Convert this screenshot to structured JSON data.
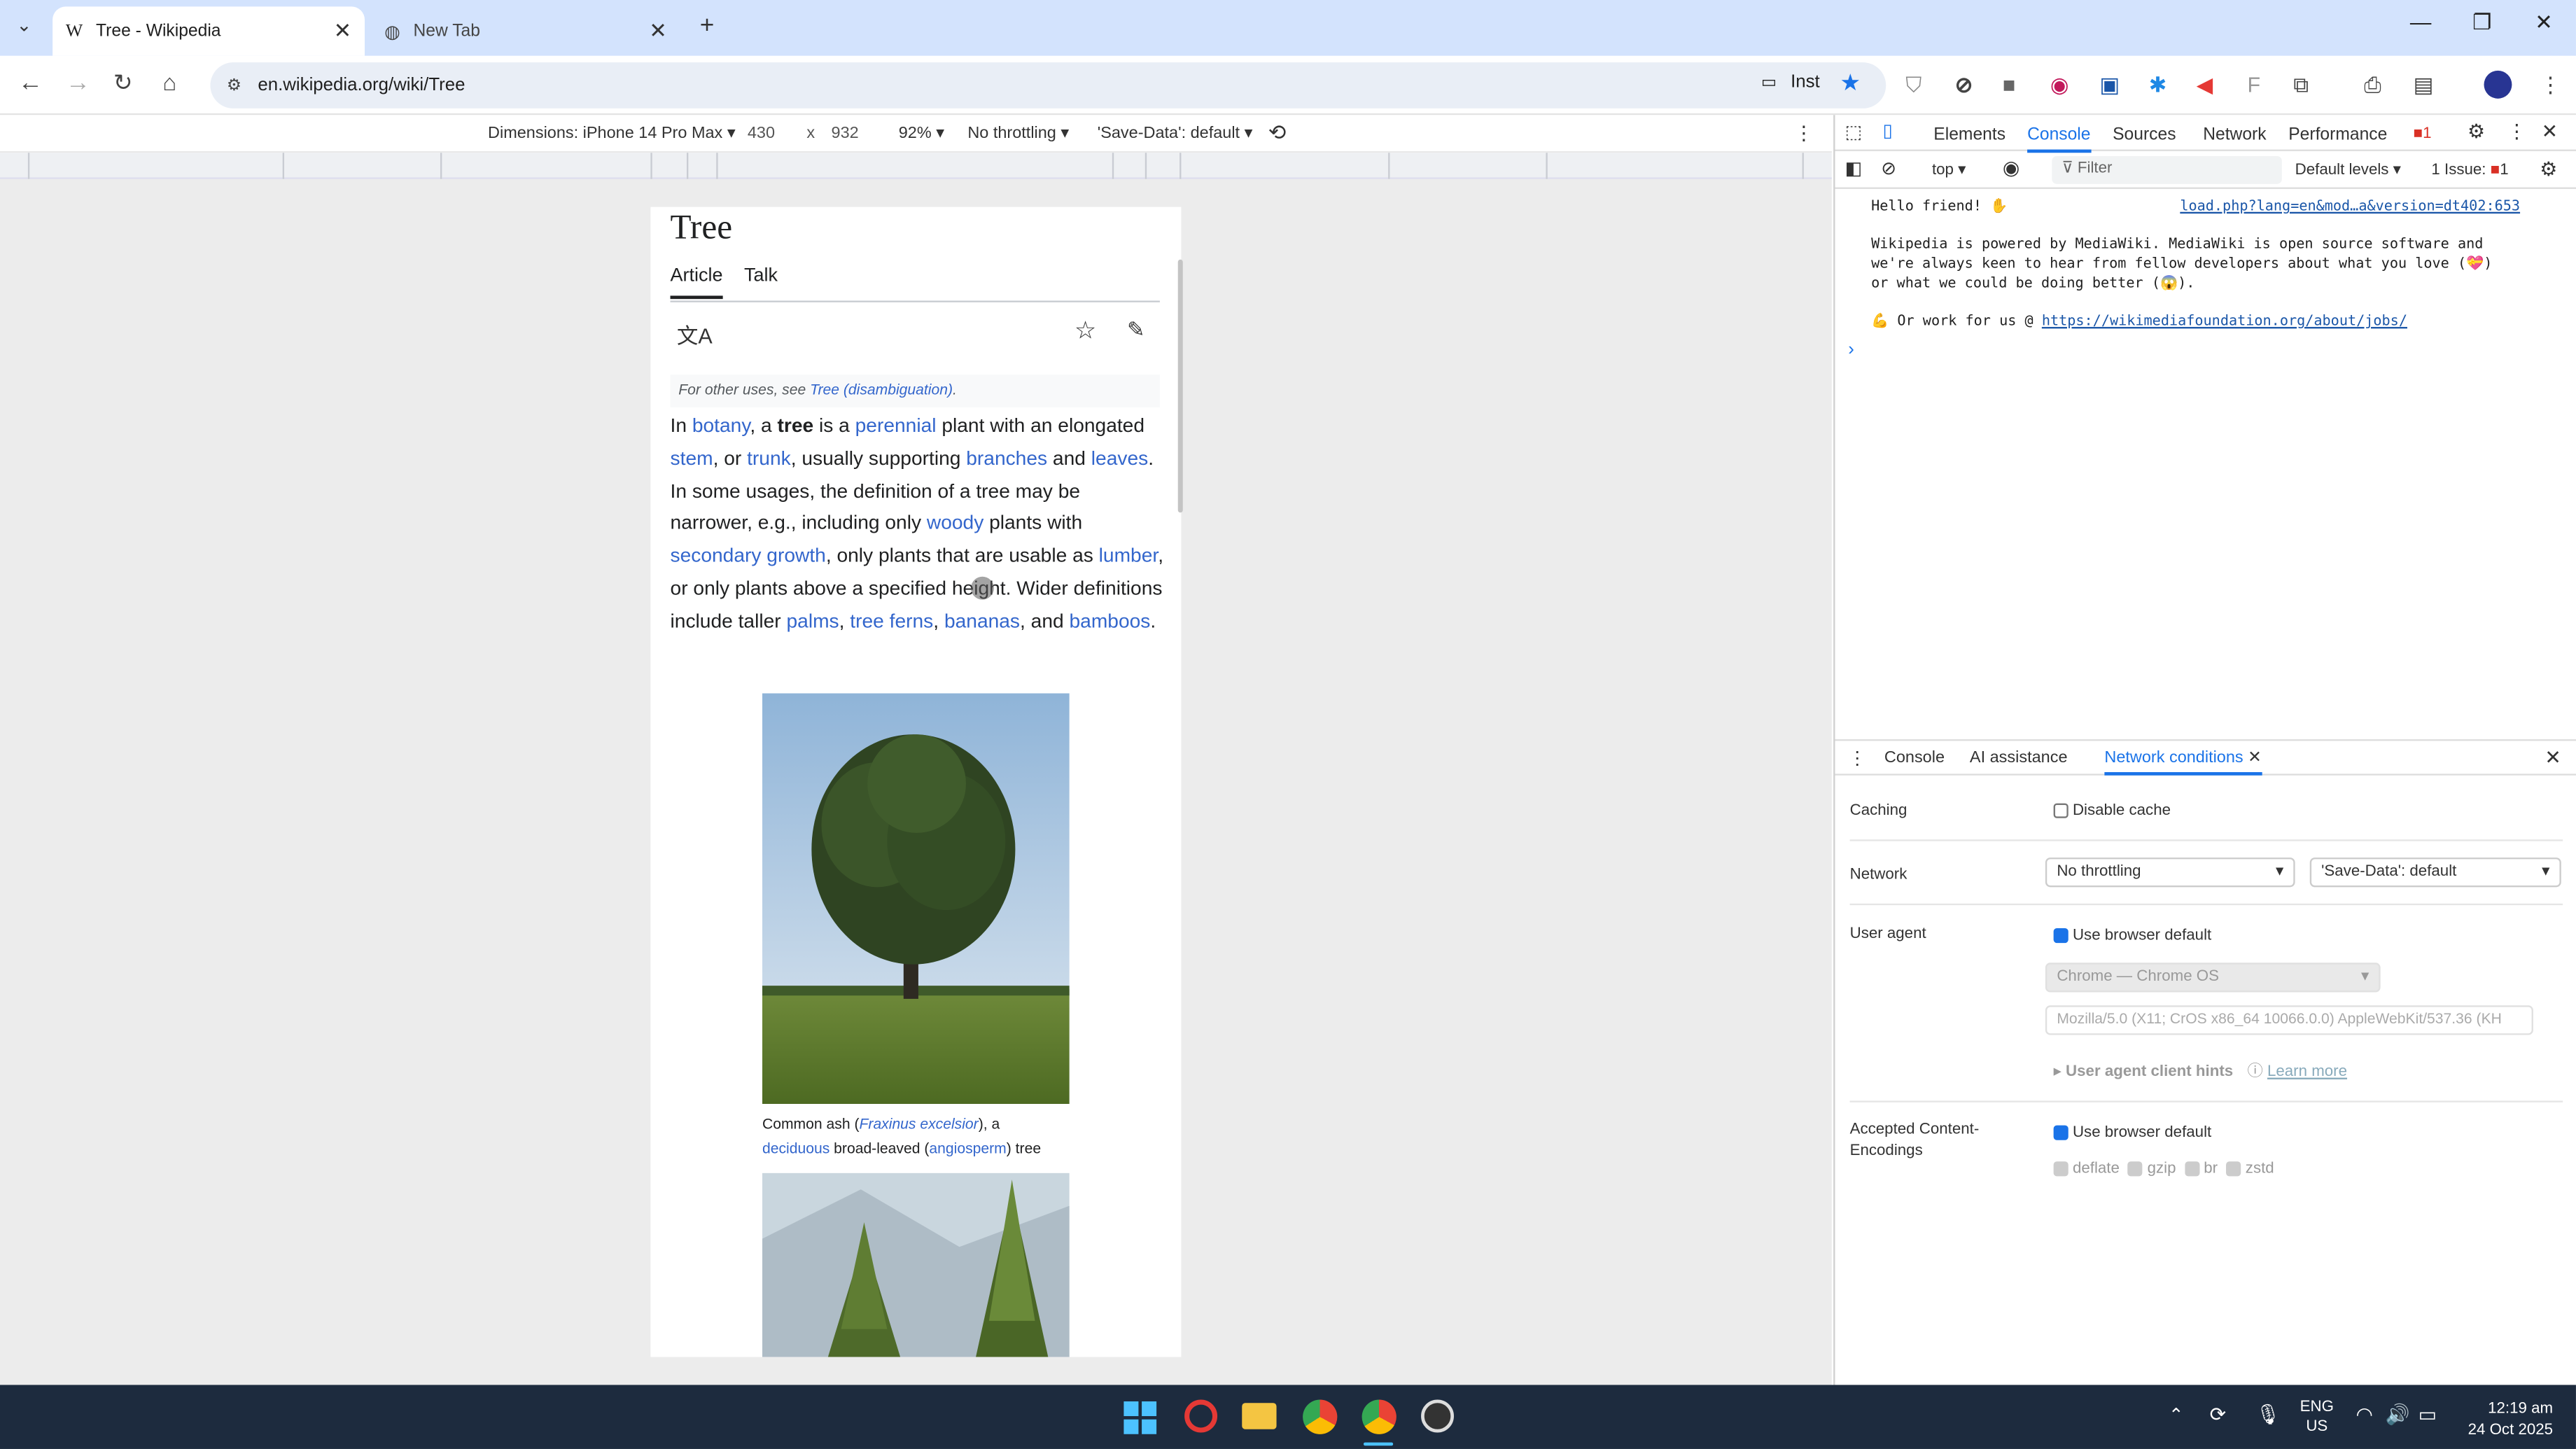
{
  "browser": {
    "tabs": [
      {
        "title": "Tree - Wikipedia",
        "favicon": "W"
      },
      {
        "title": "New Tab"
      }
    ],
    "url": "en.wikipedia.org/wiki/Tree",
    "ext_label": "Inst"
  },
  "device_toolbar": {
    "dimensions_label": "Dimensions: iPhone 14 Pro Max",
    "width": "430",
    "times": "x",
    "height": "932",
    "zoom": "92%",
    "throttling": "No throttling",
    "save_data": "'Save-Data': default"
  },
  "article": {
    "title": "Tree",
    "tab_article": "Article",
    "tab_talk": "Talk",
    "hatnote_prefix": "For other uses, see ",
    "hatnote_link": "Tree (disambiguation)",
    "hatnote_suffix": ".",
    "p": {
      "t1": "In ",
      "l_botany": "botany",
      "t2": ", a ",
      "b_tree": "tree",
      "t3": " is a ",
      "l_perennial": "perennial",
      "t4": " plant with an elongated ",
      "l_stem": "stem",
      "t5": ", or ",
      "l_trunk": "trunk",
      "t6": ", usually supporting ",
      "l_branches": "branches",
      "t7": " and ",
      "l_leaves": "leaves",
      "t8": ". In some usages, the definition of a tree may be narrower, e.g., including only ",
      "l_woody": "woody",
      "t9": " plants with ",
      "l_secondary": "secondary growth",
      "t10": ", only plants that are usable as ",
      "l_lumber": "lumber",
      "t11": ", or only plants above a specified height. Wider definitions include taller ",
      "l_palms": "palms",
      "t12": ", ",
      "l_treeferns": "tree ferns",
      "t13": ", ",
      "l_bananas": "bananas",
      "t14": ", and ",
      "l_bamboos": "bamboos",
      "t15": "."
    },
    "caption": {
      "c1": "Common ash (",
      "c_link": "Fraxinus excelsior",
      "c2": "), a",
      "c_deciduous": "deciduous",
      "c3": " broad-leaved (",
      "c_angio": "angiosperm",
      "c4": ") tree"
    }
  },
  "devtools": {
    "tabs": [
      "Elements",
      "Console",
      "Sources",
      "Network",
      "Performance"
    ],
    "active_tab": "Console",
    "error_badge": "1",
    "context": "top",
    "filter_placeholder": "Filter",
    "levels": "Default levels",
    "issues_label": "1 Issue:",
    "issues_count": "1",
    "console": {
      "hello": "Hello friend!",
      "source_link": "load.php?lang=en&mod…a&version=dt402:653",
      "msg1": "Wikipedia is powered by MediaWiki. MediaWiki is open source software and",
      "msg2": "we're always keen to hear from fellow developers about what you love (💝)",
      "msg3": "or what we could be doing better (😱).",
      "jobs_prefix": "Or work for us @ ",
      "jobs_link": "https://wikimediafoundation.org/about/jobs/"
    },
    "drawer_tabs": [
      "Console",
      "AI assistance",
      "Network conditions"
    ],
    "netcond": {
      "caching_label": "Caching",
      "disable_cache": "Disable cache",
      "network_label": "Network",
      "network_value": "No throttling",
      "savedata_value": "'Save-Data': default",
      "ua_label": "User agent",
      "use_default": "Use browser default",
      "ua_select": "Chrome — Chrome OS",
      "ua_string": "Mozilla/5.0 (X11; CrOS x86_64 10066.0.0) AppleWebKit/537.36 (KH",
      "ua_hints": "User agent client hints",
      "learn_more": "Learn more",
      "ace_label_1": "Accepted Content-",
      "ace_label_2": "Encodings",
      "ace_default": "Use browser default",
      "encodings": [
        "deflate",
        "gzip",
        "br",
        "zstd"
      ]
    }
  },
  "taskbar": {
    "lang": "ENG",
    "region": "US",
    "time": "12:19 am",
    "date": "24 Oct 2025"
  },
  "colors": {
    "accent": "#1a73e8",
    "link": "#3366cc",
    "tabstrip": "#d3e3fd",
    "taskbar": "#1d2b3e"
  }
}
